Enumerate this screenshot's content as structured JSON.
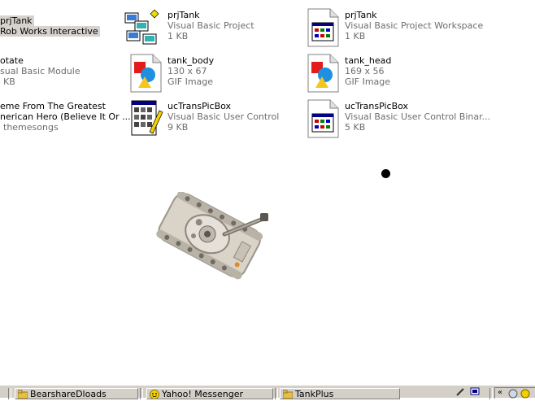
{
  "files": [
    {
      "name": "prjTank",
      "type": "Rob Works Interactive",
      "size": "",
      "icon": "vb-project-icon",
      "selected": true
    },
    {
      "name": "prjTank",
      "type": "Visual Basic Project",
      "size": "1 KB",
      "icon": "vb-project-icon"
    },
    {
      "name": "prjTank",
      "type": "Visual Basic Project Workspace",
      "size": "1 KB",
      "icon": "vb-workspace-icon"
    },
    {
      "name": "otate",
      "type": "sual Basic Module",
      "size": "KB",
      "icon": "vb-module-icon"
    },
    {
      "name": "tank_body",
      "type": "GIF Image",
      "size": "130 x 67",
      "icon": "gif-image-icon"
    },
    {
      "name": "tank_head",
      "type": "GIF Image",
      "size": "169 x 56",
      "icon": "gif-image-icon"
    },
    {
      "name": "eme From The Greatest",
      "type": "nerican Hero (Believe It Or ...",
      "size": "themesongs",
      "icon": "music-file-icon"
    },
    {
      "name": "ucTransPicBox",
      "type": "Visual Basic User Control",
      "size": "9 KB",
      "icon": "vb-usercontrol-icon"
    },
    {
      "name": "ucTransPicBox",
      "type": "Visual Basic User Control Binar...",
      "size": "5 KB",
      "icon": "vb-binary-icon"
    }
  ],
  "taskbar": {
    "items": [
      {
        "label": "BearshareDloads",
        "icon": "folder-icon"
      },
      {
        "label": "Yahoo! Messenger",
        "icon": "yahoo-messenger-icon"
      },
      {
        "label": "TankPlus",
        "icon": "folder-icon"
      }
    ]
  }
}
